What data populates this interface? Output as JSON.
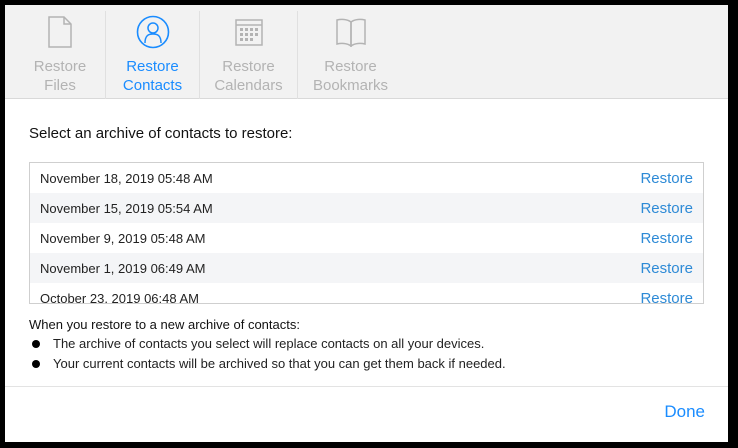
{
  "tabs": [
    {
      "label_1": "Restore",
      "label_2": "Files",
      "icon": "document-icon"
    },
    {
      "label_1": "Restore",
      "label_2": "Contacts",
      "icon": "person-icon"
    },
    {
      "label_1": "Restore",
      "label_2": "Calendars",
      "icon": "calendar-icon"
    },
    {
      "label_1": "Restore",
      "label_2": "Bookmarks",
      "icon": "book-icon"
    }
  ],
  "heading": "Select an archive of contacts to restore:",
  "archives": [
    {
      "date": "November 18, 2019 05:48 AM",
      "action": "Restore"
    },
    {
      "date": "November 15, 2019 05:54 AM",
      "action": "Restore"
    },
    {
      "date": "November 9, 2019 05:48 AM",
      "action": "Restore"
    },
    {
      "date": "November 1, 2019 06:49 AM",
      "action": "Restore"
    },
    {
      "date": "October 23, 2019 06:48 AM",
      "action": "Restore"
    }
  ],
  "note": {
    "title": "When you restore to a new archive of contacts:",
    "bullets": [
      "The archive of contacts you select will replace contacts on all your devices.",
      "Your current contacts will be archived so that you can get them back if needed."
    ]
  },
  "done_label": "Done",
  "colors": {
    "accent": "#1a8cff",
    "link": "#2d8ad6",
    "inactive": "#b3b3b3"
  }
}
